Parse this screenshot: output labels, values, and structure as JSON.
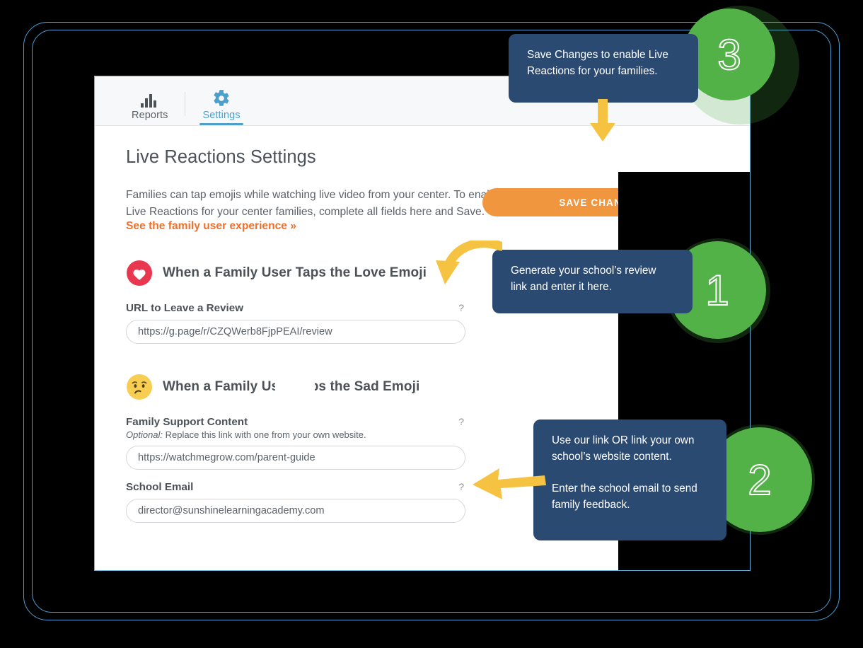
{
  "window": {
    "background_color": "#000000",
    "frame_outline_color": "#4a9fd4"
  },
  "app": {
    "nav": {
      "tabs": [
        {
          "id": "reports",
          "label": "Reports",
          "icon": "bar-chart-icon",
          "active": false
        },
        {
          "id": "settings",
          "label": "Settings",
          "icon": "gear-icon",
          "active": true
        }
      ],
      "active_color": "#4d9fcc",
      "inactive_color": "#5b6268"
    },
    "page_title": "Live Reactions Settings",
    "save_button": {
      "label": "SAVE CHANGES",
      "color": "#f0963f"
    },
    "intro": {
      "line1": "Families can tap emojis while watching live video from your center. To enable",
      "line2": "Live Reactions for your center families, complete all fields here and Save.",
      "link": "See the family user experience »",
      "link_color": "#f0702c"
    },
    "sections": [
      {
        "id": "love",
        "emoji": "heart-emoji",
        "emoji_color": "#e8374f",
        "heading": "When a Family User Taps the Love Emoji",
        "fields": [
          {
            "id": "review-url",
            "label": "URL to Leave a Review",
            "help": "?",
            "hint": "",
            "value": "https://g.page/r/CZQWerb8FjpPEAI/review"
          }
        ]
      },
      {
        "id": "sad",
        "emoji": "sad-face-emoji",
        "emoji_color": "#f5c242",
        "heading": "When a Family User Taps the Sad Emoji",
        "heading_visible": "Wher        mily User Taps the Sad Emoji",
        "fields": [
          {
            "id": "family-support-content",
            "label": "Family Support Content",
            "help": "?",
            "hint_prefix": "Optional:",
            "hint": " Replace this link with one from your own website.",
            "value": "https://watchmegrow.com/parent-guide"
          },
          {
            "id": "school-email",
            "label": "School Email",
            "help": "?",
            "hint": "",
            "value": "director@sunshinelearningacademy.com"
          }
        ]
      }
    ]
  },
  "callouts": [
    {
      "id": "callout-1",
      "number": "1",
      "lines": [
        "Generate your school’s review",
        "link and enter it here."
      ],
      "paragraphs": [
        [
          "Generate your school’s review",
          "link and enter it here."
        ]
      ]
    },
    {
      "id": "callout-2",
      "number": "2",
      "paragraphs": [
        [
          "Use our link OR link your own",
          "school’s website content."
        ],
        [
          "Enter the school email to send",
          "family feedback."
        ]
      ]
    },
    {
      "id": "callout-3",
      "number": "3",
      "paragraphs": [
        [
          "Save Changes to enable Live",
          "Reactions for your families."
        ]
      ]
    }
  ],
  "colors": {
    "callout_bg": "#2b4a72",
    "badge_green": "#52b147",
    "arrow_yellow": "#f5c242",
    "accent_orange": "#f0963f"
  }
}
